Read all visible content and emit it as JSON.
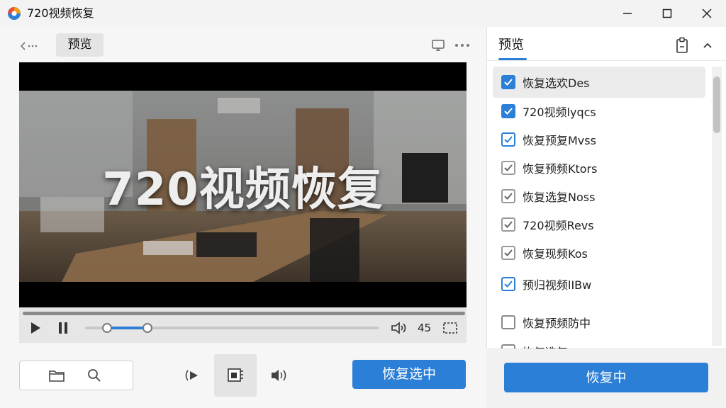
{
  "window": {
    "title": "720视频恢复",
    "controls": [
      "minimize-icon",
      "maximize-icon",
      "close-icon"
    ]
  },
  "left": {
    "tab_label": "预览",
    "video": {
      "overlay_text": "720视频恢复"
    },
    "controls": {
      "time": "45",
      "volume_fraction": 0.2
    }
  },
  "toolbar": {
    "action_label": "恢复选中"
  },
  "right": {
    "title": "预览",
    "items": [
      {
        "label": "恢复选欢Des",
        "state": "checked-blue"
      },
      {
        "label": "720视频lyqcs",
        "state": "checked-blue"
      },
      {
        "label": "恢复预复Mvss",
        "state": "checked-outline"
      },
      {
        "label": "恢复预频Ktors",
        "state": "checked-grey"
      },
      {
        "label": "恢复选复Noss",
        "state": "checked-grey"
      },
      {
        "label": "720视频Revs",
        "state": "checked-grey"
      },
      {
        "label": "恢复现频Kos",
        "state": "checked-grey"
      },
      {
        "label": "预归视频lIBw",
        "state": "checked-outline"
      },
      {
        "label": "恢复预频防中",
        "state": "unchecked"
      }
    ],
    "partial_item_label": "恢复选复",
    "footer_button_label": "恢复中"
  },
  "colors": {
    "accent": "#2c7fd6",
    "background": "#f3f3f3"
  }
}
